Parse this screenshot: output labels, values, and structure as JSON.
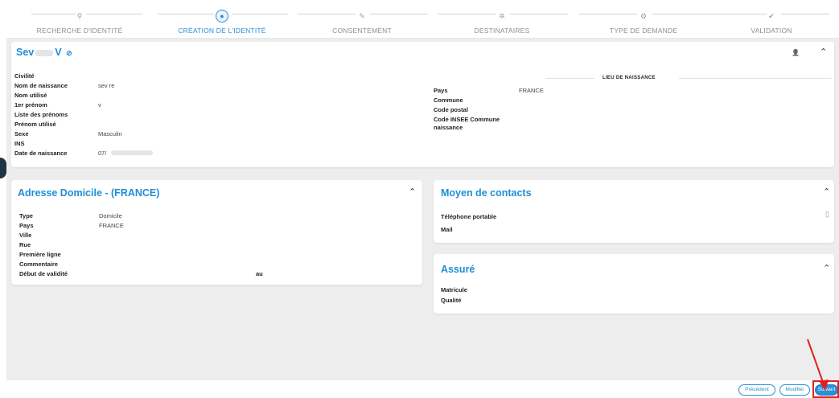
{
  "stepper": {
    "steps": [
      {
        "label": "RECHERCHE D'IDENTITÉ",
        "icon": "search-icon",
        "glyph": "⚲",
        "active": false
      },
      {
        "label": "CRÉATION DE L'IDENTITÉ",
        "icon": "user-icon",
        "glyph": "●",
        "active": true
      },
      {
        "label": "CONSENTEMENT",
        "icon": "edit-icon",
        "glyph": "✎",
        "active": false
      },
      {
        "label": "DESTINATAIRES",
        "icon": "group-icon",
        "glyph": "✲",
        "active": false
      },
      {
        "label": "TYPE DE DEMANDE",
        "icon": "settings-icon",
        "glyph": "⚙",
        "active": false
      },
      {
        "label": "VALIDATION",
        "icon": "check-icon",
        "glyph": "✔",
        "active": false
      }
    ]
  },
  "identity": {
    "name_prefix": "Sev",
    "name_suffix": "V",
    "verify_glyph": "⊘",
    "person_glyph": "👤",
    "collapse_glyph": "⌃",
    "fields": [
      {
        "label": "Civilité",
        "value": ""
      },
      {
        "label": "Nom de naissance",
        "value": "sev   re"
      },
      {
        "label": "Nom utilisé",
        "value": ""
      },
      {
        "label": "1er prénom",
        "value": "v"
      },
      {
        "label": "Liste des prénoms",
        "value": ""
      },
      {
        "label": "Prénom utilisé",
        "value": ""
      },
      {
        "label": "Sexe",
        "value": "Masculin"
      },
      {
        "label": "INS",
        "value": ""
      },
      {
        "label": "Date de naissance",
        "value": "07/"
      }
    ],
    "birthplace_title": "LIEU DE NAISSANCE",
    "birthplace": [
      {
        "label": "Pays",
        "value": "FRANCE"
      },
      {
        "label": "Commune",
        "value": ""
      },
      {
        "label": "Code postal",
        "value": ""
      },
      {
        "label": "Code INSEE Commune",
        "value": ""
      },
      {
        "label": "naissance",
        "value": ""
      }
    ]
  },
  "address": {
    "title": "Adresse Domicile - (FRANCE)",
    "collapse_glyph": "⌃",
    "fields": [
      {
        "label": "Type",
        "value": "Domicile"
      },
      {
        "label": "Pays",
        "value": "FRANCE"
      },
      {
        "label": "Ville",
        "value": ""
      },
      {
        "label": "Rue",
        "value": ""
      },
      {
        "label": "Première ligne",
        "value": ""
      },
      {
        "label": "Commentaire",
        "value": ""
      },
      {
        "label": "Début de validité",
        "value": "au"
      }
    ]
  },
  "contacts": {
    "title": "Moyen de contacts",
    "collapse_glyph": "⌃",
    "phone_label": "Téléphone portable",
    "phone_glyph": "▯",
    "mail_label": "Mail"
  },
  "insured": {
    "title": "Assuré",
    "collapse_glyph": "⌃",
    "matricule_label": "Matricule",
    "qualite_label": "Qualité"
  },
  "footer": {
    "previous_label": "Précédent",
    "modify_label": "Modifier",
    "next_label": "Suivant"
  },
  "colors": {
    "accent": "#2a8fd4",
    "highlight": "#e02020"
  }
}
